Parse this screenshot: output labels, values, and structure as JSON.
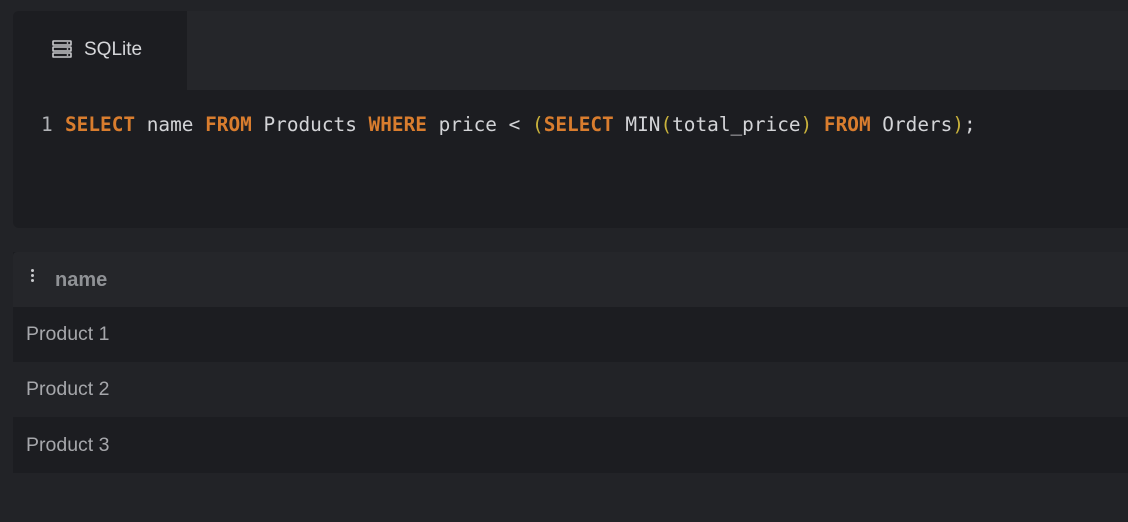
{
  "tab": {
    "label": "SQLite",
    "icon": "database-icon"
  },
  "editor": {
    "line_number": "1",
    "tokens": {
      "t1": "SELECT",
      "t2": " name ",
      "t3": "FROM",
      "t4": " Products ",
      "t5": "WHERE",
      "t6": " price < ",
      "t7": "(",
      "t8": "SELECT",
      "t9": " MIN",
      "t10": "(",
      "t11": "total_price",
      "t12": ")",
      "t13": " ",
      "t14": "FROM",
      "t15": " Orders",
      "t16": ")",
      "t17": ";"
    }
  },
  "results": {
    "columns": [
      "name"
    ],
    "rows": [
      [
        "Product 1"
      ],
      [
        "Product 2"
      ],
      [
        "Product 3"
      ]
    ],
    "column_menu_icon": "kebab-menu-icon"
  },
  "colors": {
    "keyword": "#d97d2e",
    "paren": "#c9b23c",
    "background": "#222327"
  }
}
